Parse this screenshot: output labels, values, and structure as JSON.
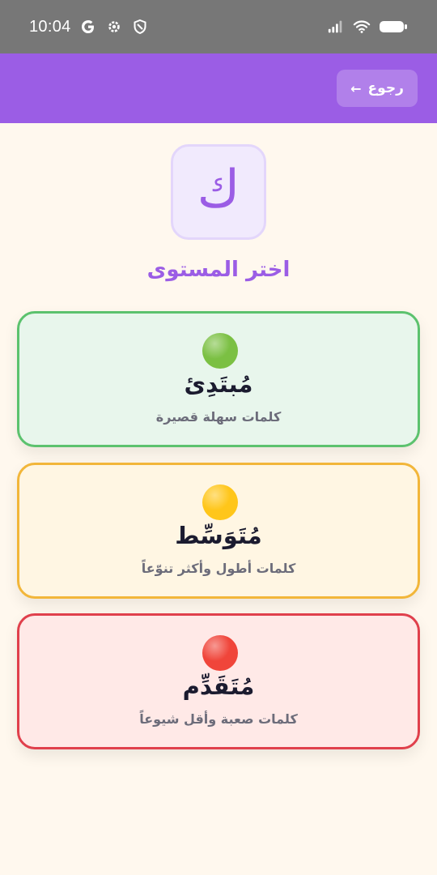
{
  "status_bar": {
    "time": "10:04",
    "icons": [
      "google-icon",
      "gear-icon",
      "shield-icon",
      "signal-icon",
      "wifi-icon",
      "battery-icon"
    ]
  },
  "header": {
    "back_label": "رجوع",
    "back_arrow": "←",
    "bg_color": "#9B5DE5"
  },
  "logo": {
    "letter": "ك"
  },
  "page_title": "اختر المستوى",
  "levels": [
    {
      "name": "مُبتَدِئ",
      "description": "كلمات سهلة قصيرة",
      "dot_color": "#7BC043",
      "border_color": "#5CC26E",
      "bg_color": "#E8F6EC"
    },
    {
      "name": "مُتَوَسِّط",
      "description": "كلمات أطول وأكثر تنوّعاً",
      "dot_color": "#FFC61A",
      "border_color": "#F2B63A",
      "bg_color": "#FFF6E3"
    },
    {
      "name": "مُتَقَدِّم",
      "description": "كلمات صعبة وأقل شيوعاً",
      "dot_color": "#F0453A",
      "border_color": "#E0404C",
      "bg_color": "#FFE9E7"
    }
  ]
}
